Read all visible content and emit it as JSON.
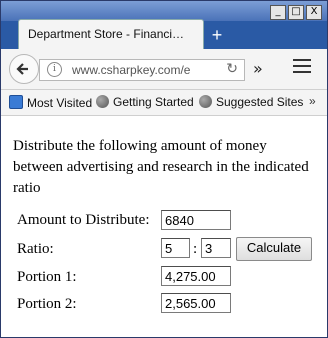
{
  "window": {
    "minimize_glyph": "_",
    "maximize_glyph": "□",
    "close_glyph": "X"
  },
  "tab": {
    "title": "Department Store - Financi…",
    "new_tab_glyph": "+"
  },
  "navbar": {
    "url": "www.csharpkey.com/e",
    "info_glyph": "i",
    "reload_glyph": "↻",
    "overflow_glyph": "»"
  },
  "bookmarks": [
    {
      "label": "Most Visited",
      "icon": "most-visited-icon"
    },
    {
      "label": "Getting Started",
      "icon": "globe-icon"
    },
    {
      "label": "Suggested Sites",
      "icon": "globe-icon"
    }
  ],
  "bookmarks_overflow": "»",
  "page": {
    "intro": "Distribute the following amount of money between advertising and research in the indicated ratio",
    "amount_label": "Amount to Distribute:",
    "amount_value": "6840",
    "ratio_label": "Ratio:",
    "ratio_left": "5",
    "ratio_colon": ":",
    "ratio_right": "3",
    "calculate_label": "Calculate",
    "portion1_label": "Portion 1:",
    "portion1_value": "4,275.00",
    "portion2_label": "Portion 2:",
    "portion2_value": "2,565.00"
  }
}
